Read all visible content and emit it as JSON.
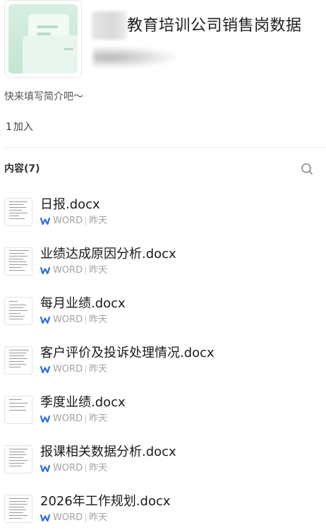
{
  "group": {
    "title": "教育培训公司销售岗数据",
    "intro": "快来填写简介吧～",
    "member_count": "1",
    "member_label": "加入"
  },
  "content": {
    "label": "内容(7)",
    "search_icon": "search-icon"
  },
  "files": [
    {
      "name": "日报.docx",
      "type": "WORD",
      "time": "昨天"
    },
    {
      "name": "业绩达成原因分析.docx",
      "type": "WORD",
      "time": "昨天"
    },
    {
      "name": "每月业绩.docx",
      "type": "WORD",
      "time": "昨天"
    },
    {
      "name": "客户评价及投诉处理情况.docx",
      "type": "WORD",
      "time": "昨天"
    },
    {
      "name": "季度业绩.docx",
      "type": "WORD",
      "time": "昨天"
    },
    {
      "name": "报课相关数据分析.docx",
      "type": "WORD",
      "time": "昨天"
    },
    {
      "name": "2026年工作规划.docx",
      "type": "WORD",
      "time": "昨天"
    }
  ],
  "colors": {
    "word_blue": "#2b6de5",
    "cover_green": "#c3e6d3",
    "meta_gray": "#a3a3a3"
  }
}
